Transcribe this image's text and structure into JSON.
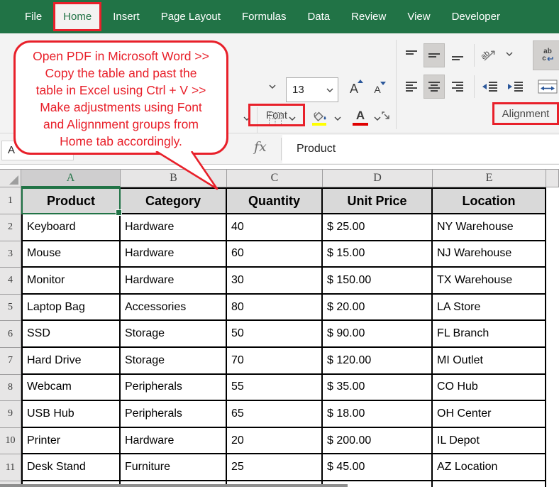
{
  "menu": {
    "tabs": [
      "File",
      "Home",
      "Insert",
      "Page Layout",
      "Formulas",
      "Data",
      "Review",
      "View",
      "Developer"
    ],
    "active": "Home"
  },
  "ribbon": {
    "font_size_value": "13",
    "font_group_label": "Font",
    "alignment_group_label": "Alignment",
    "icons": {
      "grow_font": "A",
      "shrink_font": "A",
      "font_color_letter": "A",
      "orientation_text": "ab",
      "wrap_line1": "ab",
      "wrap_line2": "c",
      "chevron_down": "v-shape",
      "borders": "dashed-grid",
      "fill_color": "paint-bucket+yellow-bar",
      "font_color": "A+red-bar",
      "dialog_launcher": "corner-arrow",
      "align_top": "lines-top",
      "align_middle": "lines-middle",
      "align_bottom": "lines-bottom",
      "align_left": "lines-left",
      "align_center": "lines-center",
      "align_right": "lines-right",
      "indent_decrease": "left-arrow+lines",
      "indent_increase": "right-arrow+lines",
      "merge_center": "cell+double-arrow",
      "select_all": "gray-triangle"
    }
  },
  "callout": {
    "text": "Open PDF in Microsoft Word >>\nCopy the table and past the\ntable in Excel using Ctrl + V >>\nMake adjustments using Font\nand Alignnment groups from\nHome tab accordingly."
  },
  "formula_bar": {
    "name_box": "A",
    "fx_label": "fx",
    "value": "Product"
  },
  "grid": {
    "column_letters": [
      "A",
      "B",
      "C",
      "D",
      "E"
    ],
    "selected_column_index": 0,
    "selected_cell": "A1",
    "row_numbers": [
      "1",
      "2",
      "3",
      "4",
      "5",
      "6",
      "7",
      "8",
      "9",
      "10",
      "11"
    ],
    "header_row": [
      "Product",
      "Category",
      "Quantity",
      "Unit Price",
      "Location"
    ],
    "data_rows": [
      [
        "Keyboard",
        "Hardware",
        "40",
        "$ 25.00",
        "NY Warehouse"
      ],
      [
        "Mouse",
        "Hardware",
        "60",
        "$ 15.00",
        "NJ Warehouse"
      ],
      [
        "Monitor",
        "Hardware",
        "30",
        "$ 150.00",
        "TX Warehouse"
      ],
      [
        "Laptop Bag",
        "Accessories",
        "80",
        "$ 20.00",
        "LA Store"
      ],
      [
        "SSD",
        "Storage",
        "50",
        "$ 90.00",
        "FL Branch"
      ],
      [
        "Hard Drive",
        "Storage",
        "70",
        "$ 120.00",
        "MI Outlet"
      ],
      [
        "Webcam",
        "Peripherals",
        "55",
        "$ 35.00",
        "CO Hub"
      ],
      [
        "USB Hub",
        "Peripherals",
        "65",
        "$ 18.00",
        "OH Center"
      ],
      [
        "Printer",
        "Hardware",
        "20",
        "$ 200.00",
        "IL Depot"
      ],
      [
        "Desk Stand",
        "Furniture",
        "25",
        "$ 45.00",
        "AZ Location"
      ]
    ]
  },
  "colors": {
    "excel_green": "#217346",
    "annotation_red": "#e8202a",
    "header_fill": "#d9d9d9",
    "ribbon_gray": "#f3f3f3",
    "selection_green": "#217346",
    "highlight_yellow": "#ffff00",
    "font_color_red": "#e00000",
    "icon_blue": "#2b579a"
  }
}
